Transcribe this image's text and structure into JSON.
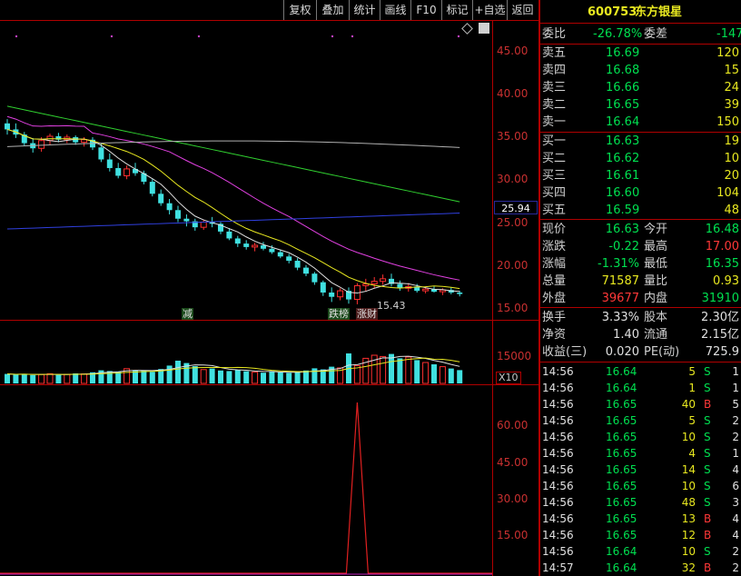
{
  "toolbar": {
    "buttons": [
      "复权",
      "叠加",
      "统计",
      "画线",
      "F10",
      "标记",
      "+自选",
      "返回"
    ]
  },
  "stock": {
    "code": "600753",
    "name": "东方银星"
  },
  "main_chart": {
    "y_ticks": [
      "45.00",
      "40.00",
      "35.00",
      "30.00",
      "25.00",
      "20.00",
      "15.00"
    ],
    "current_price_box": "25.94",
    "low_marker": "15.43",
    "tags": [
      "减",
      "跌榜",
      "涨财"
    ]
  },
  "volume_chart": {
    "y_tick": "15000",
    "scale": "X10"
  },
  "indicator_chart": {
    "y_ticks": [
      "60.00",
      "45.00",
      "30.00",
      "15.00"
    ]
  },
  "order_book": {
    "weibi_label": "委比",
    "weibi_value": "-26.78%",
    "weicha_label": "委差",
    "weicha_value": "-147",
    "asks": [
      {
        "label": "卖五",
        "price": "16.69",
        "vol": "120"
      },
      {
        "label": "卖四",
        "price": "16.68",
        "vol": "15"
      },
      {
        "label": "卖三",
        "price": "16.66",
        "vol": "24"
      },
      {
        "label": "卖二",
        "price": "16.65",
        "vol": "39"
      },
      {
        "label": "卖一",
        "price": "16.64",
        "vol": "150"
      }
    ],
    "bids": [
      {
        "label": "买一",
        "price": "16.63",
        "vol": "19"
      },
      {
        "label": "买二",
        "price": "16.62",
        "vol": "10"
      },
      {
        "label": "买三",
        "price": "16.61",
        "vol": "20"
      },
      {
        "label": "买四",
        "price": "16.60",
        "vol": "104"
      },
      {
        "label": "买五",
        "price": "16.59",
        "vol": "48"
      }
    ]
  },
  "quote": {
    "rows": [
      {
        "l1": "现价",
        "v1": "16.63",
        "l2": "今开",
        "v2": "16.48",
        "c1": "g",
        "c2": "g"
      },
      {
        "l1": "涨跌",
        "v1": "-0.22",
        "l2": "最高",
        "v2": "17.00",
        "c1": "g",
        "c2": "r"
      },
      {
        "l1": "涨幅",
        "v1": "-1.31%",
        "l2": "最低",
        "v2": "16.35",
        "c1": "g",
        "c2": "g"
      },
      {
        "l1": "总量",
        "v1": "71587",
        "l2": "量比",
        "v2": "0.93",
        "c1": "y",
        "c2": "y"
      },
      {
        "l1": "外盘",
        "v1": "39677",
        "l2": "内盘",
        "v2": "31910",
        "c1": "r",
        "c2": "g"
      }
    ]
  },
  "stats": {
    "rows": [
      {
        "l1": "换手",
        "v1": "3.33%",
        "l2": "股本",
        "v2": "2.30亿"
      },
      {
        "l1": "净资",
        "v1": "1.40",
        "l2": "流通",
        "v2": "2.15亿"
      },
      {
        "l1": "收益(三)",
        "v1": "0.020",
        "l2": "PE(动)",
        "v2": "725.9"
      }
    ]
  },
  "ticks": [
    {
      "time": "14:56",
      "price": "16.64",
      "vol": "5",
      "side": "S",
      "n": "1"
    },
    {
      "time": "14:56",
      "price": "16.64",
      "vol": "1",
      "side": "S",
      "n": "1"
    },
    {
      "time": "14:56",
      "price": "16.65",
      "vol": "40",
      "side": "B",
      "n": "5"
    },
    {
      "time": "14:56",
      "price": "16.65",
      "vol": "5",
      "side": "S",
      "n": "2"
    },
    {
      "time": "14:56",
      "price": "16.65",
      "vol": "10",
      "side": "S",
      "n": "2"
    },
    {
      "time": "14:56",
      "price": "16.65",
      "vol": "4",
      "side": "S",
      "n": "1"
    },
    {
      "time": "14:56",
      "price": "16.65",
      "vol": "14",
      "side": "S",
      "n": "4"
    },
    {
      "time": "14:56",
      "price": "16.65",
      "vol": "10",
      "side": "S",
      "n": "6"
    },
    {
      "time": "14:56",
      "price": "16.65",
      "vol": "48",
      "side": "S",
      "n": "3"
    },
    {
      "time": "14:56",
      "price": "16.65",
      "vol": "13",
      "side": "B",
      "n": "4"
    },
    {
      "time": "14:56",
      "price": "16.65",
      "vol": "12",
      "side": "B",
      "n": "4"
    },
    {
      "time": "14:56",
      "price": "16.64",
      "vol": "10",
      "side": "S",
      "n": "2"
    },
    {
      "time": "14:57",
      "price": "16.64",
      "vol": "32",
      "side": "B",
      "n": "2"
    }
  ],
  "candles": [
    [
      36.5,
      37.0,
      35.2,
      35.8
    ],
    [
      35.8,
      36.5,
      34.8,
      35.2
    ],
    [
      35.2,
      35.5,
      33.9,
      34.2
    ],
    [
      34.2,
      34.8,
      33.1,
      33.6
    ],
    [
      33.6,
      34.9,
      33.2,
      34.5
    ],
    [
      34.5,
      35.3,
      34.0,
      35.0
    ],
    [
      35.0,
      35.4,
      34.3,
      34.6
    ],
    [
      34.6,
      35.2,
      34.2,
      34.9
    ],
    [
      34.9,
      35.1,
      34.0,
      34.3
    ],
    [
      34.3,
      34.9,
      33.8,
      34.6
    ],
    [
      34.6,
      34.9,
      33.4,
      33.7
    ],
    [
      33.7,
      34.2,
      32.0,
      32.3
    ],
    [
      32.3,
      33.0,
      30.9,
      31.3
    ],
    [
      31.3,
      31.9,
      30.1,
      30.4
    ],
    [
      30.4,
      31.6,
      30.0,
      31.2
    ],
    [
      31.2,
      31.9,
      30.4,
      30.7
    ],
    [
      30.7,
      31.0,
      29.4,
      29.7
    ],
    [
      29.7,
      30.0,
      28.0,
      28.3
    ],
    [
      28.3,
      28.8,
      26.9,
      27.2
    ],
    [
      27.2,
      27.7,
      25.9,
      26.4
    ],
    [
      26.4,
      26.9,
      25.0,
      25.4
    ],
    [
      25.4,
      25.9,
      24.5,
      25.1
    ],
    [
      25.1,
      25.4,
      24.0,
      24.4
    ],
    [
      24.4,
      25.3,
      24.1,
      25.0
    ],
    [
      25.0,
      25.6,
      24.4,
      24.8
    ],
    [
      24.8,
      25.0,
      23.6,
      23.9
    ],
    [
      23.9,
      24.3,
      22.9,
      23.1
    ],
    [
      23.1,
      23.4,
      22.1,
      22.5
    ],
    [
      22.5,
      22.9,
      21.8,
      22.1
    ],
    [
      22.1,
      22.6,
      21.6,
      22.3
    ],
    [
      22.3,
      22.7,
      21.7,
      21.9
    ],
    [
      21.9,
      22.3,
      21.3,
      21.5
    ],
    [
      21.5,
      21.8,
      20.8,
      21.0
    ],
    [
      21.0,
      21.3,
      20.2,
      20.5
    ],
    [
      20.5,
      20.8,
      19.4,
      19.7
    ],
    [
      19.7,
      20.0,
      18.7,
      19.0
    ],
    [
      19.0,
      19.2,
      17.7,
      18.0
    ],
    [
      18.0,
      18.2,
      16.4,
      16.8
    ],
    [
      16.8,
      17.4,
      15.7,
      16.3
    ],
    [
      16.3,
      17.3,
      15.9,
      17.0
    ],
    [
      17.0,
      17.4,
      15.5,
      16.0
    ],
    [
      16.0,
      17.9,
      15.43,
      17.6
    ],
    [
      17.6,
      18.4,
      17.0,
      17.8
    ],
    [
      17.8,
      18.6,
      17.3,
      18.1
    ],
    [
      18.1,
      18.9,
      17.7,
      18.4
    ],
    [
      18.4,
      19.0,
      17.5,
      17.8
    ],
    [
      17.8,
      18.2,
      17.0,
      17.3
    ],
    [
      17.3,
      17.9,
      16.9,
      17.5
    ],
    [
      17.5,
      17.8,
      16.8,
      17.0
    ],
    [
      17.0,
      17.5,
      16.7,
      17.2
    ],
    [
      17.2,
      17.5,
      16.8,
      16.9
    ],
    [
      16.9,
      17.3,
      16.5,
      17.1
    ],
    [
      17.1,
      17.4,
      16.6,
      16.8
    ],
    [
      16.8,
      17.0,
      16.35,
      16.63
    ]
  ],
  "volumes": [
    5200,
    4800,
    5100,
    4600,
    4900,
    5300,
    4700,
    5000,
    5500,
    5200,
    6100,
    7200,
    6800,
    6500,
    8100,
    7300,
    7000,
    6400,
    7900,
    9800,
    12500,
    11200,
    9500,
    7600,
    8200,
    7100,
    6800,
    7400,
    6700,
    6200,
    5900,
    6500,
    6100,
    5800,
    6300,
    7100,
    8300,
    7700,
    9200,
    8500,
    16500,
    9800,
    13800,
    15500,
    14800,
    16200,
    13800,
    14500,
    12800,
    11500,
    10500,
    9200,
    8200,
    7300
  ],
  "indicator_peak_index": 41
}
